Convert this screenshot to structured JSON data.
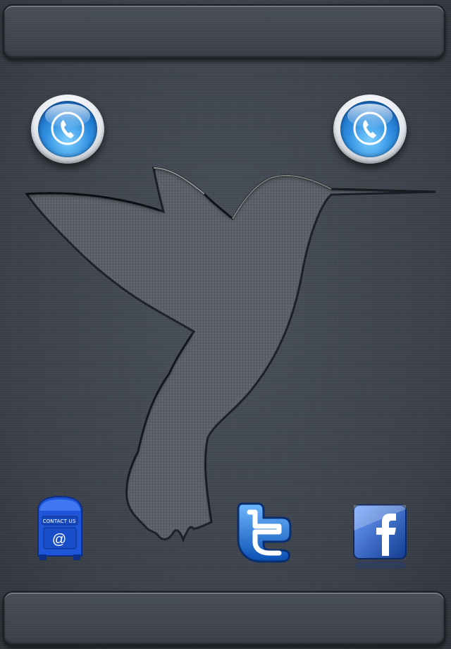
{
  "header_bar": {},
  "footer_bar": {},
  "call_buttons": [
    {
      "icon": "phone-icon",
      "accent": "#2f8fe0"
    },
    {
      "icon": "phone-icon",
      "accent": "#2f8fe0"
    }
  ],
  "logo": {
    "icon": "hummingbird-icon"
  },
  "social": {
    "contact": {
      "icon": "mailbox-icon",
      "label": "CONTACT US",
      "symbol": "@",
      "color": "#1e56d6"
    },
    "twitter": {
      "icon": "twitter-icon",
      "color": "#1a73d9"
    },
    "facebook": {
      "icon": "facebook-icon",
      "color": "#2a5db0"
    }
  },
  "colors": {
    "background": "#3f454e",
    "bar": "#3a3f47"
  }
}
